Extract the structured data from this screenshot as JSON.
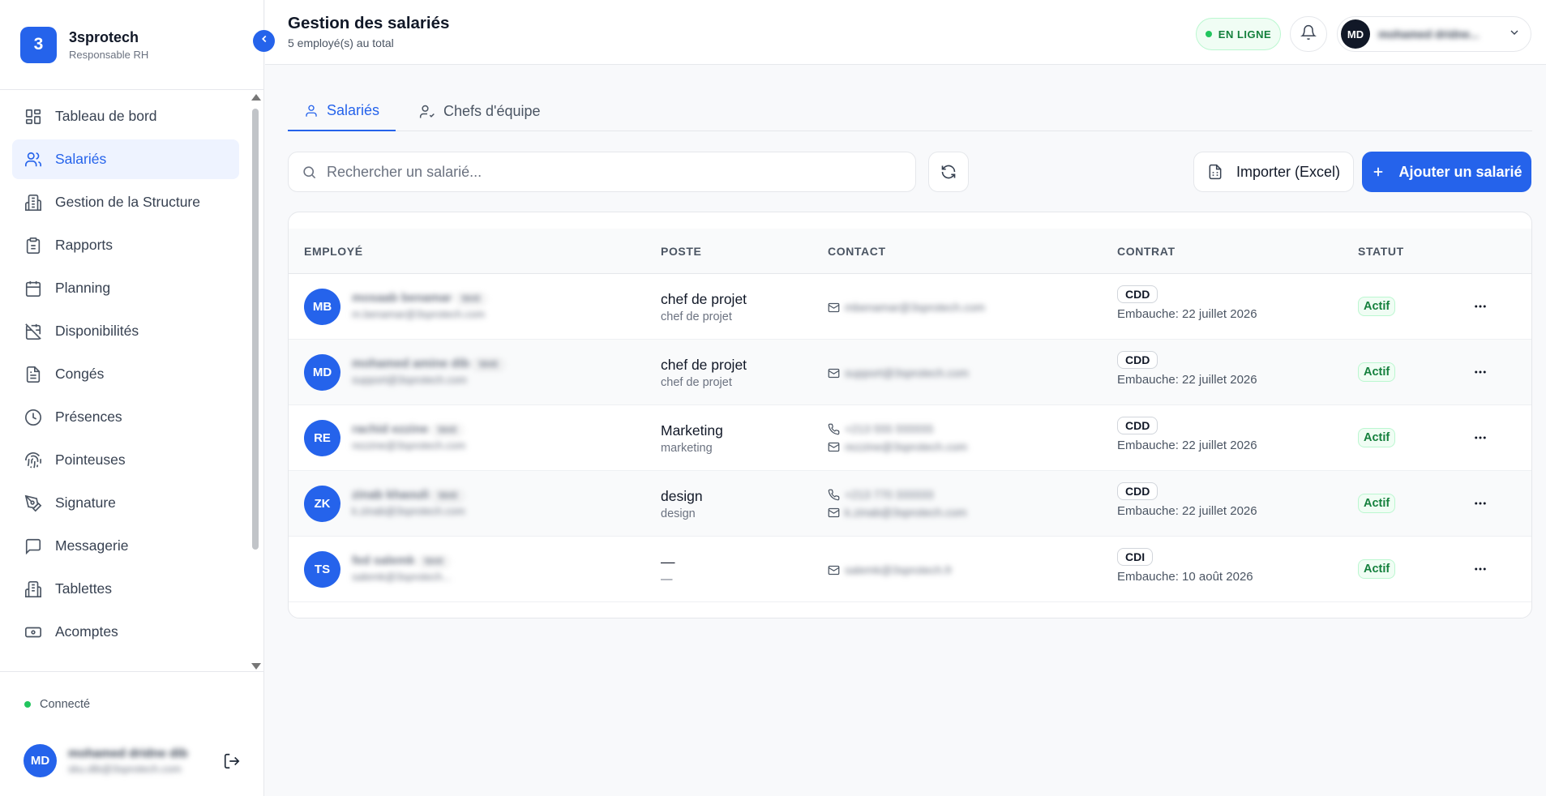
{
  "brand": {
    "logo_letter": "3",
    "name": "3sprotech",
    "role": "Responsable RH"
  },
  "sidebar": {
    "items": [
      {
        "label": "Tableau de bord",
        "icon": "dashboard-icon",
        "active": false
      },
      {
        "label": "Salariés",
        "icon": "users-icon",
        "active": true
      },
      {
        "label": "Gestion de la Structure",
        "icon": "building-icon",
        "active": false
      },
      {
        "label": "Rapports",
        "icon": "clipboard-icon",
        "active": false
      },
      {
        "label": "Planning",
        "icon": "calendar-icon",
        "active": false
      },
      {
        "label": "Disponibilités",
        "icon": "calendar-off-icon",
        "active": false
      },
      {
        "label": "Congés",
        "icon": "file-icon",
        "active": false
      },
      {
        "label": "Présences",
        "icon": "clock-icon",
        "active": false
      },
      {
        "label": "Pointeuses",
        "icon": "fingerprint-icon",
        "active": false
      },
      {
        "label": "Signature",
        "icon": "signature-icon",
        "active": false
      },
      {
        "label": "Messagerie",
        "icon": "message-icon",
        "active": false
      },
      {
        "label": "Tablettes",
        "icon": "tablet-icon",
        "active": false
      },
      {
        "label": "Acomptes",
        "icon": "banknote-icon",
        "active": false
      }
    ],
    "footer": {
      "status": "Connecté",
      "user_initials": "MD",
      "user_name": "mohamed dridne dib",
      "user_email": "sku.dib@3sprotech.com"
    }
  },
  "header": {
    "title": "Gestion des salariés",
    "subtitle": "5 employé(s) au total",
    "online_label": "EN LIGNE",
    "user_initials": "MD",
    "user_name": "mohamed dridne..."
  },
  "tabs": [
    {
      "label": "Salariés",
      "active": true
    },
    {
      "label": "Chefs d'équipe",
      "active": false
    }
  ],
  "toolbar": {
    "search_placeholder": "Rechercher un salarié...",
    "import_label": "Importer (Excel)",
    "add_label": "Ajouter un salarié"
  },
  "table": {
    "headers": [
      "EMPLOYÉ",
      "POSTE",
      "CONTACT",
      "CONTRAT",
      "STATUT"
    ],
    "rows": [
      {
        "initials": "MB",
        "name": "mosaab benamar",
        "tag": "5845",
        "email": "m.benamar@3sprotech.com",
        "poste": "chef de projet",
        "poste_sub": "chef de projet",
        "phone": "",
        "contact_email": "mbenamar@3sprotech.com",
        "contract": "CDD",
        "hire": "Embauche: 22 juillet 2026",
        "status": "Actif"
      },
      {
        "initials": "MD",
        "name": "mohamed amine dib",
        "tag": "5845",
        "email": "support@3sprotech.com",
        "poste": "chef de projet",
        "poste_sub": "chef de projet",
        "phone": "",
        "contact_email": "support@3sprotech.com",
        "contract": "CDD",
        "hire": "Embauche: 22 juillet 2026",
        "status": "Actif"
      },
      {
        "initials": "RE",
        "name": "rachid ezzine",
        "tag": "5845",
        "email": "rezzine@3sprotech.com",
        "poste": "Marketing",
        "poste_sub": "marketing",
        "phone": "+213 555 555555",
        "contact_email": "rezzine@3sprotech.com",
        "contract": "CDD",
        "hire": "Embauche: 22 juillet 2026",
        "status": "Actif"
      },
      {
        "initials": "ZK",
        "name": "zinab khaouli",
        "tag": "5845",
        "email": "k.zinab@3sprotech.com",
        "poste": "design",
        "poste_sub": "design",
        "phone": "+213 770 333333",
        "contact_email": "k.zinab@3sprotech.com",
        "contract": "CDD",
        "hire": "Embauche: 22 juillet 2026",
        "status": "Actif"
      },
      {
        "initials": "TS",
        "name": "fed salemk",
        "tag": "5845",
        "email": "salemk@3sprotech...",
        "poste": "—",
        "poste_sub": "—",
        "phone": "",
        "contact_email": "salemk@3sprotech.fr",
        "contract": "CDI",
        "hire": "Embauche: 10 août 2026",
        "status": "Actif"
      }
    ]
  },
  "colors": {
    "accent": "#2563eb",
    "success": "#15803d",
    "success_bg": "#f0fdf4"
  }
}
